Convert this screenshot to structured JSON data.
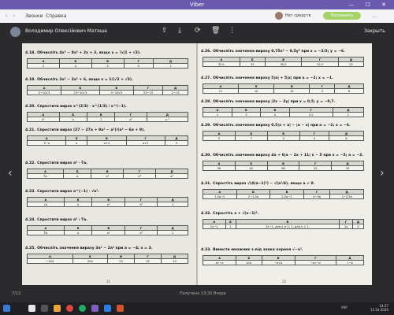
{
  "window": {
    "title": "Viber"
  },
  "menu": {
    "back": "‹",
    "forward": "›",
    "items": [
      "Звонки",
      "Справка"
    ],
    "net_status": "Нет средств",
    "status_button": "Пополнить",
    "more": "…"
  },
  "viewer": {
    "sender": "Володимир Олексійович Матеша",
    "close_label": "Закрыть",
    "page_counter": "7/13",
    "caption": "Получено 13:20 Вчера"
  },
  "icons": [
    "share-icon",
    "download-icon",
    "rotate-icon",
    "trash-icon",
    "more-icon"
  ],
  "worksheet": {
    "left": [
      {
        "n": "4.18.",
        "text": "Обчисліть 4x³ − 8x² + 2x + 3, якщо x = ½(1 + √3).",
        "head": [
          "А",
          "Б",
          "В",
          "Г",
          "Д"
        ],
        "row": [
          "2",
          "4",
          "5",
          "0",
          "1"
        ]
      },
      {
        "n": "4.19.",
        "text": "Обчисліть 3x³ − 2x² + 6, якщо x = 1/(√2 + √3).",
        "head": [
          "А",
          "Б",
          "В",
          "Г",
          "Д"
        ],
        "row": [
          "2−10√3",
          "23−10√3",
          "3−10√3",
          "23−√3",
          "2−√3"
        ]
      },
      {
        "n": "4.20.",
        "text": "Спростити вираз x^(2/3) · x^(1/3) / x^(−1).",
        "head": [
          "А",
          "Б",
          "В",
          "Г",
          "Д"
        ],
        "row": [
          "x²",
          "x",
          "1",
          "x³",
          "x⁻¹"
        ]
      },
      {
        "n": "4.21.",
        "text": "Спростити вираз (27 − 27a + 9a² − a³)/(a² − 6a + 9).",
        "head": [
          "А",
          "Б",
          "В",
          "Г",
          "Д"
        ],
        "row": [
          "3−a",
          "a",
          "a+3",
          "a+2",
          "3"
        ]
      },
      {
        "n": "4.22.",
        "text": "Спростити вираз a³ · ∛a.",
        "head": [
          "А",
          "Б",
          "В",
          "Г",
          "Д"
        ],
        "row": [
          "∛a",
          "a",
          "a²",
          "a³",
          "a⁴"
        ]
      },
      {
        "n": "4.23.",
        "text": "Спростити вираз a^(−1) · √a³.",
        "head": [
          "А",
          "Б",
          "В",
          "Г",
          "Д"
        ],
        "row": [
          "√a",
          "a",
          "a²",
          "a³",
          "1"
        ]
      },
      {
        "n": "4.24.",
        "text": "Спростити вираз a⁵ : ∜a.",
        "head": [
          "А",
          "Б",
          "В",
          "Г",
          "Д"
        ],
        "row": [
          "∜a",
          "a",
          "a²",
          "a³",
          "1"
        ]
      },
      {
        "n": "4.25.",
        "text": "Обчисліть значення виразу 3a³ − 2a² при a = −4; x = 3.",
        "head": [
          "А",
          "Б",
          "В",
          "Г",
          "Д"
        ],
        "row": [
          "−204",
          "204",
          "53",
          "35",
          "10"
        ]
      }
    ],
    "right": [
      {
        "n": "4.26.",
        "text": "Обчисліть значення виразу 0,75x² − 0,5y² при x = −2/3; y = −6.",
        "head": [
          "А",
          "Б",
          "В",
          "Г",
          "Д"
        ],
        "row": [
          "32⅓",
          "32",
          "30,5",
          "32,5",
          "25"
        ]
      },
      {
        "n": "4.27.",
        "text": "Обчисліть значення виразу 5|a| + 5|x| при a = −2; x = −1.",
        "head": [
          "А",
          "Б",
          "В",
          "Г",
          "Д"
        ],
        "row": [
          "11",
          "10",
          "15",
          "3",
          "6"
        ]
      },
      {
        "n": "4.28.",
        "text": "Обчисліть значення виразу |2x − 3y| при x = 0,5; y = −0,7.",
        "head": [
          "А",
          "Б",
          "В",
          "Г",
          "Д"
        ],
        "row": [
          "2",
          "3",
          "4",
          "3,1",
          "1"
        ]
      },
      {
        "n": "4.29.",
        "text": "Обчисліть значення виразу 0,5|x + a| − |a − x| при a = −2; x = −6.",
        "head": [
          "А",
          "Б",
          "В",
          "Г",
          "Д"
        ],
        "row": [
          "5",
          "7",
          "3",
          "4",
          "6"
        ]
      },
      {
        "n": "4.30.",
        "text": "Обчисліть значення виразу 4a + 6|a − 2x + 11| x − 5 при x = −5; a = −2.",
        "head": [
          "А",
          "Б",
          "В",
          "Г",
          "Д"
        ],
        "row": [
          "56",
          "40",
          "66",
          "25",
          "30"
        ]
      },
      {
        "n": "4.31.",
        "text": "Спростіть вираз √(4(a−1)²) − √(a²/4), якщо a < 0.",
        "head": [
          "А",
          "Б",
          "В",
          "Г",
          "Д"
        ],
        "row": [
          "1,5a−2",
          "2−1,5a",
          "2,5a−2",
          "4−5a",
          "2−2,5a"
        ]
      },
      {
        "n": "4.32.",
        "text": "Спростіть x + √(x−1)².",
        "head": [
          "А",
          "Б",
          "В",
          "Г",
          "Д"
        ],
        "row": [
          "2x−1",
          "1",
          "2x−1, для x ≥ 1; 1, для x < 1.",
          "2x",
          "0"
        ]
      },
      {
        "n": "4.33.",
        "text": "Винести множник з-під знака кореня √−a³.",
        "head": [
          "А",
          "Б",
          "В",
          "Г",
          "Д"
        ],
        "row": [
          "a√−a",
          "a√a",
          "−a√a",
          "−a√−a",
          "√−a"
        ]
      }
    ],
    "left_page_number": "21",
    "right_page_number": "22"
  },
  "taskbar": {
    "time": "14:27",
    "date": "13.10.2020",
    "lang": "УКР"
  }
}
